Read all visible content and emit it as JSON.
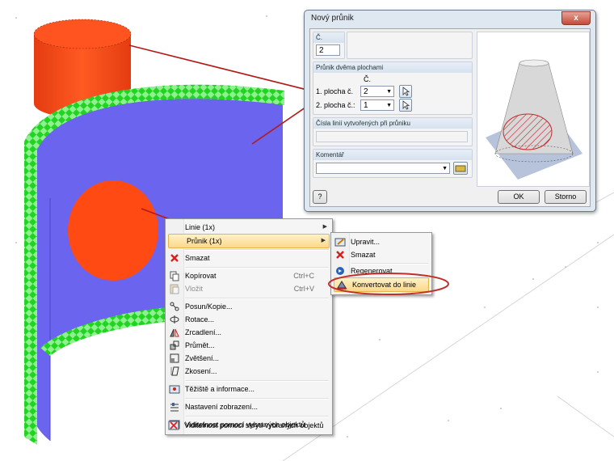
{
  "scene": {
    "red_cylinder_color": "#f04a1a",
    "shell_color": "#6c66f0",
    "support_color": "#2de22d",
    "hole_color": "#ff4a12",
    "arrow_color": "#b01c1c",
    "highlight_ring_color": "#c0302a"
  },
  "menu": {
    "items": [
      {
        "label": "Linie (1x)",
        "has_submenu": true
      },
      {
        "label": "Průnik (1x)",
        "has_submenu": true,
        "highlighted": true
      },
      {
        "label": "Smazat",
        "icon": "delete-x-icon"
      },
      {
        "label": "Kopírovat",
        "shortcut": "Ctrl+C",
        "icon": "copy-icon"
      },
      {
        "label": "Vložit",
        "shortcut": "Ctrl+V",
        "icon": "paste-icon",
        "disabled": true
      },
      {
        "label": "Posun/Kopie...",
        "icon": "move-copy-icon"
      },
      {
        "label": "Rotace...",
        "icon": "rotate-icon"
      },
      {
        "label": "Zrcadlení...",
        "icon": "mirror-icon"
      },
      {
        "label": "Průmět...",
        "icon": "project-icon"
      },
      {
        "label": "Zvětšení...",
        "icon": "scale-icon"
      },
      {
        "label": "Zkosení...",
        "icon": "shear-icon"
      },
      {
        "label": "Těžiště a informace...",
        "icon": "centroid-info-icon"
      },
      {
        "label": "Nastavení zobrazení...",
        "icon": "display-settings-icon"
      },
      {
        "label": "Viditelnost pomocí vybraných objektů",
        "icon": "visibility-selected-icon"
      },
      {
        "label": "Viditelnost pomocí skrytí vybraných objektů",
        "icon": "visibility-hide-icon"
      }
    ]
  },
  "submenu": {
    "items": [
      {
        "label": "Upravit...",
        "icon": "edit-icon"
      },
      {
        "label": "Smazat",
        "icon": "delete-x-icon"
      },
      {
        "label": "Regenerovat",
        "icon": "regenerate-icon"
      },
      {
        "label": "Konvertovat do linie",
        "icon": "convert-to-line-icon",
        "highlighted": true
      }
    ]
  },
  "dialog": {
    "title": "Nový průnik",
    "close_label": "x",
    "no_label": "Č.",
    "no_value": "2",
    "intersection_group": "Průnik dvěma plochami",
    "column_header": "Č.",
    "surface1_label": "1. plocha č.",
    "surface1_value": "2",
    "surface2_label": "2. plocha č.:",
    "surface2_value": "1",
    "lines_group": "Čísla linií vytvořených při průniku",
    "lines_value": "",
    "comment_group": "Komentář",
    "comment_value": "",
    "help_label": "?",
    "ok_label": "OK",
    "cancel_label": "Storno"
  }
}
